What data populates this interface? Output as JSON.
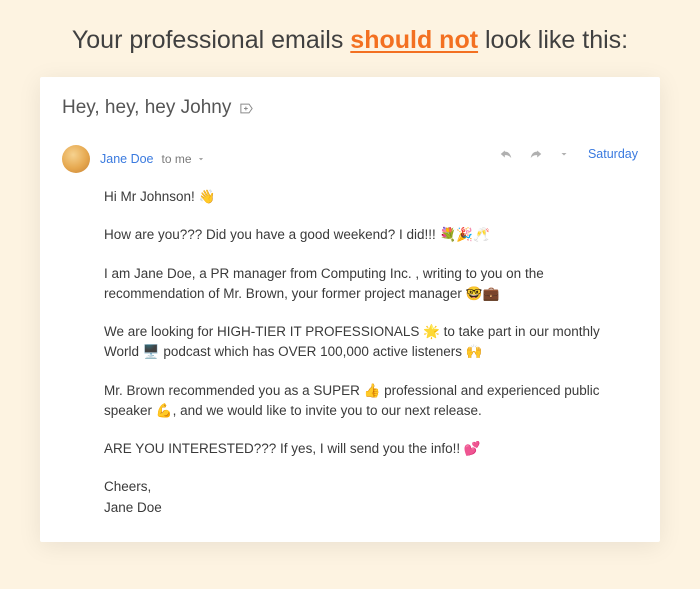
{
  "title": {
    "before": "Your professional emails ",
    "emphasis": "should not",
    "after": " look like this:"
  },
  "email": {
    "subject": "Hey, hey, hey Johny",
    "sender": "Jane Doe",
    "recipient": "to me",
    "timestamp": "Saturday",
    "body": {
      "p1": "Hi Mr Johnson! 👋",
      "p2": "How are you??? Did you have a good weekend? I did!!! 💐🎉🥂",
      "p3": "I am Jane Doe, a PR manager from Computing Inc. , writing to you on the recommendation of Mr. Brown, your former project manager 🤓💼",
      "p4": "We are looking for HIGH-TIER IT PROFESSIONALS 🌟 to take part in our monthly World 🖥️ podcast which has OVER 100,000 active listeners 🙌",
      "p5": "Mr. Brown recommended you as a SUPER 👍 professional and experienced public speaker 💪, and we would like to invite you to our next release.",
      "p6": "ARE YOU INTERESTED??? If yes, I will send you the info!! 💕",
      "cheers": "Cheers,",
      "signature": "Jane Doe"
    }
  }
}
